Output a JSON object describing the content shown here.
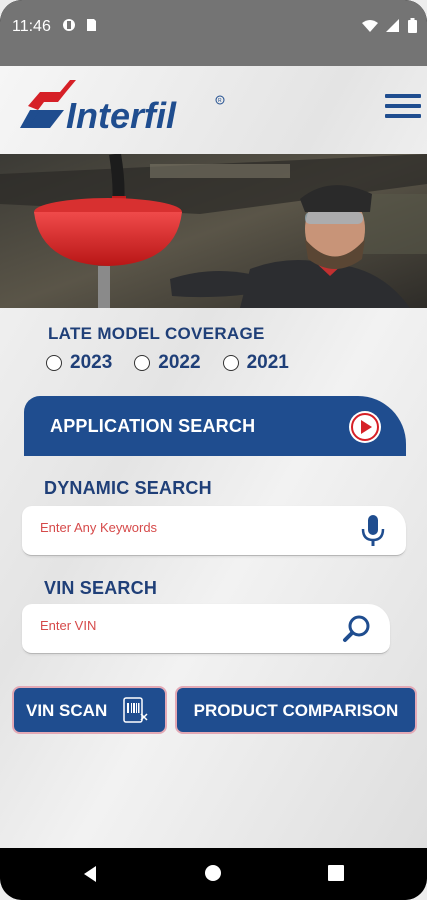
{
  "status_bar": {
    "time": "11:46",
    "left_icons": [
      "vpn-icon",
      "sd-card-icon"
    ],
    "right_icons": [
      "wifi-icon",
      "signal-icon",
      "battery-icon"
    ]
  },
  "header": {
    "logo_text": "Interfil",
    "menu_icon": "hamburger-menu-icon"
  },
  "coverage": {
    "title": "LATE MODEL COVERAGE",
    "years": [
      "2023",
      "2022",
      "2021"
    ]
  },
  "application_search": {
    "label": "APPLICATION SEARCH",
    "icon": "play-circle-icon"
  },
  "dynamic_search": {
    "title": "DYNAMIC SEARCH",
    "placeholder": "Enter Any Keywords",
    "icon": "microphone-icon"
  },
  "vin_search": {
    "title": "VIN SEARCH",
    "placeholder": "Enter VIN",
    "icon": "search-icon"
  },
  "buttons": {
    "vin_scan": "VIN SCAN",
    "product_comparison": "PRODUCT COMPARISON"
  },
  "colors": {
    "brand_blue": "#1f4d8f",
    "brand_red": "#d62027",
    "placeholder_red": "#d64a4a"
  }
}
